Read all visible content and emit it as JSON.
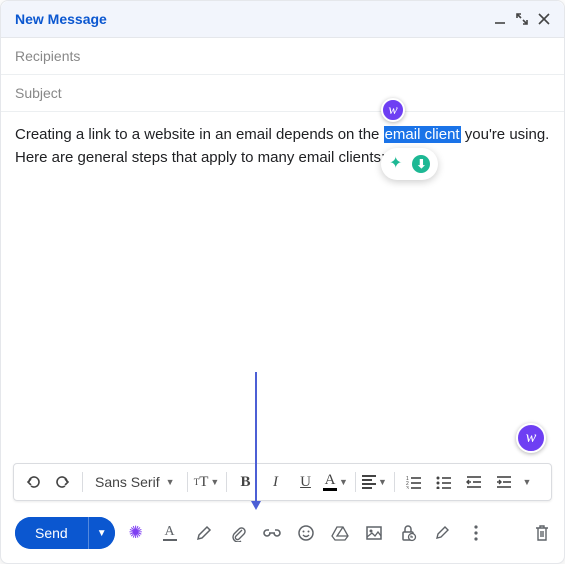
{
  "header": {
    "title": "New Message"
  },
  "fields": {
    "recipients_placeholder": "Recipients",
    "subject_placeholder": "Subject"
  },
  "body": {
    "text_before": "Creating a link to a website in an email depends on the ",
    "highlighted": "email client",
    "text_after": " you're using. Here are general steps that apply to many email clients:"
  },
  "format_bar": {
    "font": "Sans Serif"
  },
  "bottom": {
    "send_label": "Send"
  }
}
